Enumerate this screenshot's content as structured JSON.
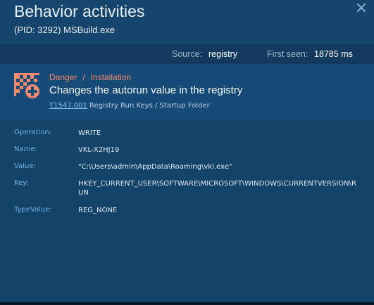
{
  "header": {
    "title": "Behavior activities",
    "subtitle": "(PID: 3292) MSBuild.exe",
    "close_label": "×"
  },
  "source_bar": {
    "source_label": "Source:",
    "source_value": "registry",
    "first_seen_label": "First seen:",
    "first_seen_value": "18785 ms"
  },
  "alert": {
    "severity": "Danger",
    "separator": "/",
    "category": "Installation",
    "title": "Changes the autorun value in the registry",
    "technique_id": "T1547.001",
    "technique_name": "Registry Run Keys / Startup Folder",
    "icon": "checkered-flag-plus-icon",
    "icon_color": "#f08a6e"
  },
  "details": [
    {
      "key": "Operation:",
      "value": "WRITE"
    },
    {
      "key": "Name:",
      "value": "VKL-X2HJ19"
    },
    {
      "key": "Value:",
      "value": "\"C:\\Users\\admin\\AppData\\Roaming\\vkl.exe\""
    },
    {
      "key": "Key:",
      "value": "HKEY_CURRENT_USER\\SOFTWARE\\MICROSOFT\\WINDOWS\\CURRENTVERSION\\RUN"
    },
    {
      "key": "TypeValue:",
      "value": "REG_NONE"
    }
  ],
  "colors": {
    "background": "#14436a",
    "accent_danger": "#f08a6e",
    "key_label": "#6fb3e3",
    "link": "#7ec4ee"
  }
}
